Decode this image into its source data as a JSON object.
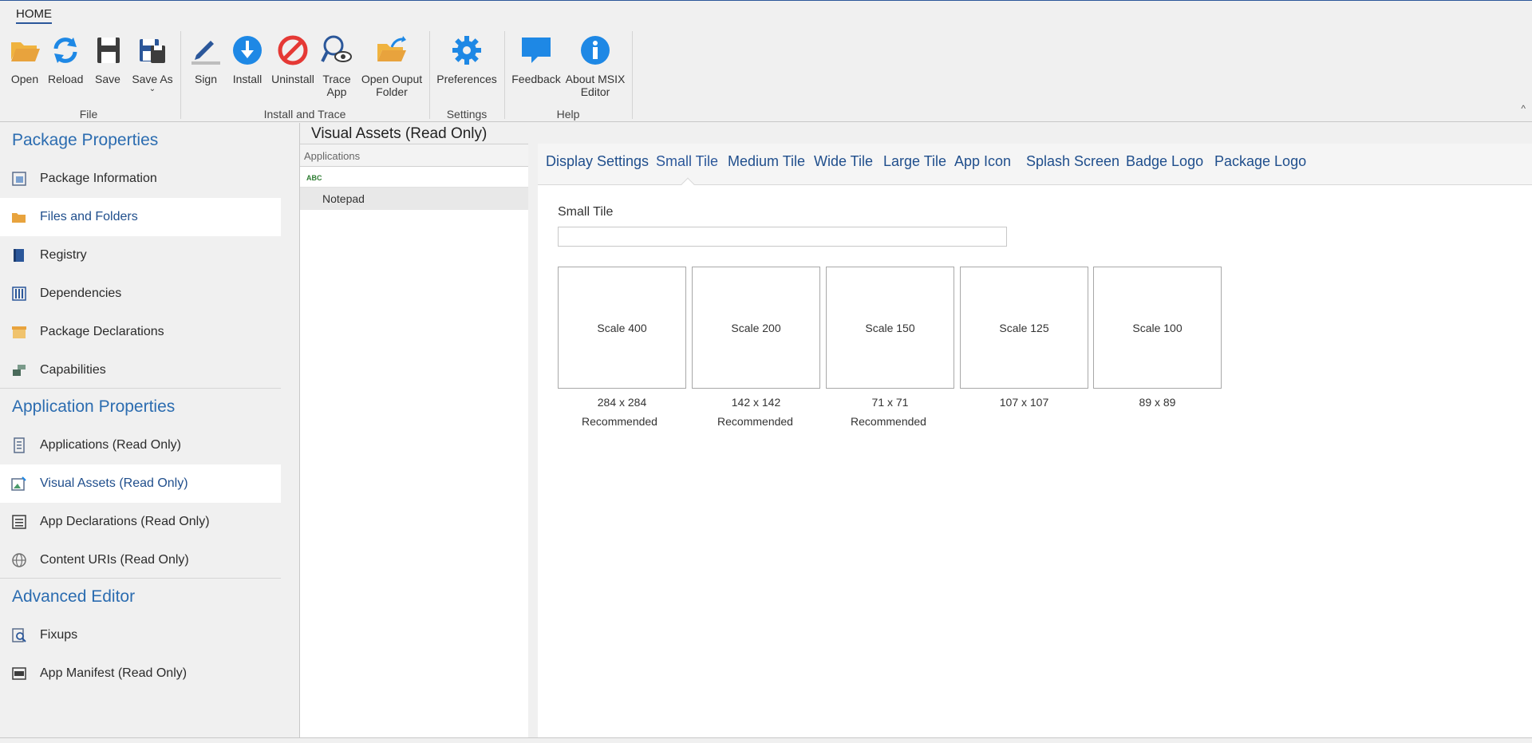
{
  "ribbon": {
    "tab_label": "HOME",
    "buttons": {
      "open": "Open",
      "reload": "Reload",
      "save": "Save",
      "save_as": "Save As",
      "sign": "Sign",
      "install": "Install",
      "uninstall": "Uninstall",
      "trace_app_line1": "Trace",
      "trace_app_line2": "App",
      "open_output_line1": "Open Ouput",
      "open_output_line2": "Folder",
      "preferences": "Preferences",
      "feedback": "Feedback",
      "about_line1": "About MSIX",
      "about_line2": "Editor"
    },
    "groups": {
      "file": "File",
      "install_trace": "Install and Trace",
      "settings": "Settings",
      "help": "Help"
    },
    "collapse_glyph": "^"
  },
  "leftnav": {
    "package_properties": "Package Properties",
    "package_information": "Package Information",
    "files_and_folders": "Files and Folders",
    "registry": "Registry",
    "dependencies": "Dependencies",
    "package_declarations": "Package Declarations",
    "capabilities": "Capabilities",
    "application_properties": "Application Properties",
    "applications": "Applications (Read Only)",
    "visual_assets": "Visual Assets (Read Only)",
    "app_declarations": "App Declarations (Read Only)",
    "content_uris": "Content URIs (Read Only)",
    "advanced_editor": "Advanced Editor",
    "fixups": "Fixups",
    "app_manifest": "App Manifest (Read Only)"
  },
  "main": {
    "title": "Visual Assets (Read Only)",
    "apps_header": "Applications",
    "apps_icon_text": "ABC",
    "app_name": "Notepad"
  },
  "tabs": {
    "display_settings": "Display Settings",
    "small_tile": "Small Tile",
    "medium_tile": "Medium Tile",
    "wide_tile": "Wide Tile",
    "large_tile": "Large Tile",
    "app_icon": "App Icon",
    "splash_screen": "Splash Screen",
    "badge_logo": "Badge Logo",
    "package_logo": "Package Logo"
  },
  "small_tile": {
    "label": "Small Tile",
    "input_value": "",
    "tiles": [
      {
        "scale": "Scale 400",
        "size": "284 x 284",
        "note": "Recommended"
      },
      {
        "scale": "Scale 200",
        "size": "142 x 142",
        "note": "Recommended"
      },
      {
        "scale": "Scale 150",
        "size": "71 x 71",
        "note": "Recommended"
      },
      {
        "scale": "Scale 125",
        "size": "107 x 107",
        "note": ""
      },
      {
        "scale": "Scale 100",
        "size": "89 x 89",
        "note": ""
      }
    ]
  },
  "colors": {
    "accent": "#2b579a",
    "link": "#1f4e8c",
    "section": "#2b6cb0",
    "open_icon": "#e8a33d",
    "info_icon": "#1e88e5",
    "stop_icon": "#e53935"
  }
}
